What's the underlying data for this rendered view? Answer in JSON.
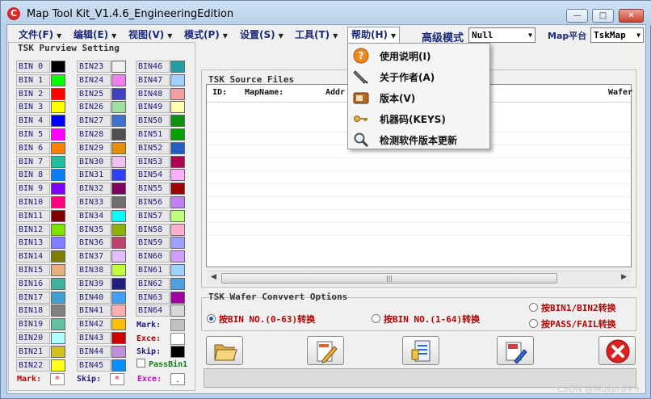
{
  "window": {
    "title": "Map Tool Kit_V1.4.6_EngineeringEdition"
  },
  "menubar": {
    "items": [
      {
        "label": "文件(F)"
      },
      {
        "label": "编辑(E)"
      },
      {
        "label": "视图(V)"
      },
      {
        "label": "模式(P)"
      },
      {
        "label": "设置(S)"
      },
      {
        "label": "工具(T)"
      },
      {
        "label": "帮助(H)"
      }
    ],
    "advanced_label": "高级模式",
    "advanced_value": "Null",
    "platform_label": "Map平台",
    "platform_value": "TskMap"
  },
  "help_menu": {
    "items": [
      {
        "label": "使用说明(I)",
        "icon": "help-icon"
      },
      {
        "label": "关于作者(A)",
        "icon": "pen-icon"
      },
      {
        "label": "版本(V)",
        "icon": "version-card-icon"
      },
      {
        "label": "机器码(KEYS)",
        "icon": "key-icon"
      },
      {
        "label": "检测软件版本更新",
        "icon": "magnifier-icon"
      }
    ]
  },
  "purview": {
    "title": "TSK Purview Setting",
    "bins": [
      {
        "label": "BIN 0",
        "color": "#000000"
      },
      {
        "label": "BIN 1",
        "color": "#00ff00"
      },
      {
        "label": "BIN 2",
        "color": "#ff0000"
      },
      {
        "label": "BIN 3",
        "color": "#ffff00"
      },
      {
        "label": "BIN 4",
        "color": "#0000ff"
      },
      {
        "label": "BIN 5",
        "color": "#ff00ff"
      },
      {
        "label": "BIN 6",
        "color": "#ff8000"
      },
      {
        "label": "BIN 7",
        "color": "#1fc0a0"
      },
      {
        "label": "BIN 8",
        "color": "#0080ff"
      },
      {
        "label": "BIN 9",
        "color": "#8000ff"
      },
      {
        "label": "BIN10",
        "color": "#ff0080"
      },
      {
        "label": "BIN11",
        "color": "#800000"
      },
      {
        "label": "BIN12",
        "color": "#80e000"
      },
      {
        "label": "BIN13",
        "color": "#8080ff"
      },
      {
        "label": "BIN14",
        "color": "#808000"
      },
      {
        "label": "BIN15",
        "color": "#e8b080"
      },
      {
        "label": "BIN16",
        "color": "#40b0a0"
      },
      {
        "label": "BIN17",
        "color": "#40a0d0"
      },
      {
        "label": "BIN18",
        "color": "#808080"
      },
      {
        "label": "BIN19",
        "color": "#60c0a0"
      },
      {
        "label": "BIN20",
        "color": "#b0ffff"
      },
      {
        "label": "BIN21",
        "color": "#d0c020"
      },
      {
        "label": "BIN22",
        "color": "#ffff20"
      },
      {
        "label": "BIN23",
        "color": "#f0f0f0"
      },
      {
        "label": "BIN24",
        "color": "#f080f0"
      },
      {
        "label": "BIN25",
        "color": "#4040c0"
      },
      {
        "label": "BIN26",
        "color": "#a0e0a0"
      },
      {
        "label": "BIN27",
        "color": "#4070d0"
      },
      {
        "label": "BIN28",
        "color": "#505050"
      },
      {
        "label": "BIN29",
        "color": "#e09000"
      },
      {
        "label": "BIN30",
        "color": "#f0c0f0"
      },
      {
        "label": "BIN31",
        "color": "#3040ff"
      },
      {
        "label": "BIN32",
        "color": "#800060"
      },
      {
        "label": "BIN33",
        "color": "#707070"
      },
      {
        "label": "BIN34",
        "color": "#00ffff"
      },
      {
        "label": "BIN35",
        "color": "#90b000"
      },
      {
        "label": "BIN36",
        "color": "#c04070"
      },
      {
        "label": "BIN37",
        "color": "#e0c0ff"
      },
      {
        "label": "BIN38",
        "color": "#c0ff40"
      },
      {
        "label": "BIN39",
        "color": "#202080"
      },
      {
        "label": "BIN40",
        "color": "#40a0ff"
      },
      {
        "label": "BIN41",
        "color": "#ffb0b0"
      },
      {
        "label": "BIN42",
        "color": "#ffc000"
      },
      {
        "label": "BIN43",
        "color": "#d00000"
      },
      {
        "label": "BIN44",
        "color": "#c090e0"
      },
      {
        "label": "BIN45",
        "color": "#0090ff"
      },
      {
        "label": "BIN46",
        "color": "#20a0a0"
      },
      {
        "label": "BIN47",
        "color": "#a0d0ff"
      },
      {
        "label": "BIN48",
        "color": "#f0a0a0"
      },
      {
        "label": "BIN49",
        "color": "#ffffb0"
      },
      {
        "label": "BIN50",
        "color": "#109010"
      },
      {
        "label": "BIN51",
        "color": "#00a000"
      },
      {
        "label": "BIN52",
        "color": "#2060c0"
      },
      {
        "label": "BIN53",
        "color": "#b00050"
      },
      {
        "label": "BIN54",
        "color": "#ffb0ff"
      },
      {
        "label": "BIN55",
        "color": "#a00000"
      },
      {
        "label": "BIN56",
        "color": "#c080f0"
      },
      {
        "label": "BIN57",
        "color": "#c0ff80"
      },
      {
        "label": "BIN58",
        "color": "#ffb0d0"
      },
      {
        "label": "BIN59",
        "color": "#a0a0ff"
      },
      {
        "label": "BIN60",
        "color": "#d0a0ff"
      },
      {
        "label": "BIN61",
        "color": "#a0d0ff"
      },
      {
        "label": "BIN62",
        "color": "#50a0e0"
      },
      {
        "label": "BIN63",
        "color": "#a000a0"
      },
      {
        "label": "BIN64",
        "color": "#d8d8d8"
      }
    ],
    "mark_col3": {
      "label": "Mark:",
      "color": "#c0c0c0"
    },
    "exce_col3": {
      "label": "Exce:",
      "color": "#ffffff"
    },
    "skip_col3": {
      "label": "Skip:",
      "color": "#000000"
    },
    "passbin": {
      "label": "PassBin1",
      "checked": false
    },
    "bottom": [
      {
        "label": "Mark:",
        "value": "*",
        "color": "#c00000"
      },
      {
        "label": "Skip:",
        "value": "*",
        "color": "#1a1a7a"
      },
      {
        "label": "Exce:",
        "value": ".",
        "color": "#d000d0"
      }
    ]
  },
  "source_files": {
    "title": "TSK Source Files",
    "columns": [
      "ID:",
      "MapName:",
      "Addr",
      "Wafer"
    ]
  },
  "convert": {
    "title": "TSK Wafer Convvert Options",
    "options": [
      {
        "label": "按BIN NO.(0-63)转换",
        "selected": true
      },
      {
        "label": "按BIN NO.(1-64)转换",
        "selected": false
      },
      {
        "label": "按BIN1/BIN2转换",
        "selected": false
      },
      {
        "label": "按PASS/FAIL转换",
        "selected": false
      }
    ]
  },
  "toolbar": {
    "buttons": [
      "open-folder",
      "edit-file",
      "list-file",
      "export-map",
      "close"
    ]
  },
  "watermark": "CSDN @Maker6++"
}
